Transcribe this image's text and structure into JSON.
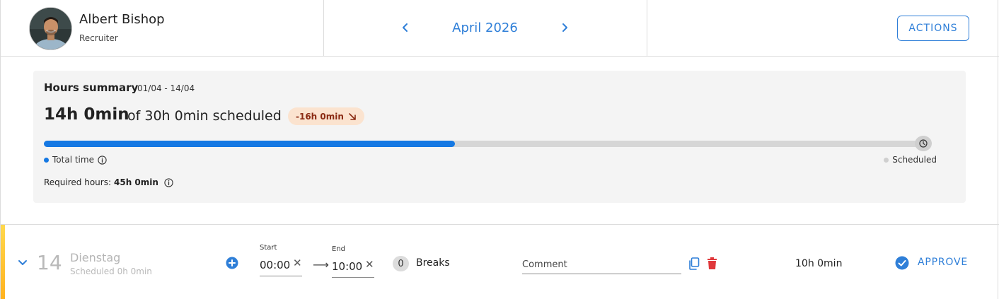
{
  "user": {
    "name": "Albert Bishop",
    "role": "Recruiter"
  },
  "period": {
    "month_label": "April 2026"
  },
  "header": {
    "actions_label": "ACTIONS"
  },
  "summary": {
    "title": "Hours summary",
    "range": "01/04 - 14/04",
    "total": "14h 0min",
    "of_scheduled": "of 30h 0min scheduled",
    "difference": "-16h 0min",
    "progress_fraction": 0.4667,
    "legend_total": "Total time",
    "legend_scheduled": "Scheduled",
    "required_label": "Required hours:",
    "required_value": "45h 0min"
  },
  "day": {
    "number": "14",
    "name": "Dienstag",
    "scheduled": "Scheduled 0h 0min",
    "start_label": "Start",
    "start_value": "00:00",
    "end_label": "End",
    "end_value": "10:00",
    "breaks_count": "0",
    "breaks_label": "Breaks",
    "comment_placeholder": "Comment",
    "total": "10h 0min",
    "approve_label": "APPROVE"
  },
  "colors": {
    "accent_blue": "#2f7fd8",
    "progress_blue": "#1578e3",
    "delete_red": "#e0383b",
    "badge_bg": "#fbe3cf",
    "day_accent": "#ffc22e"
  },
  "icons": {
    "prev": "chevron-left-icon",
    "next": "chevron-right-icon",
    "info": "info-icon",
    "clock": "clock-icon",
    "trend": "arrow-down-right-icon",
    "expand": "chevron-down-icon",
    "add": "plus-circle-icon",
    "copy": "copy-icon",
    "delete": "trash-icon",
    "approve": "check-circle-icon"
  }
}
